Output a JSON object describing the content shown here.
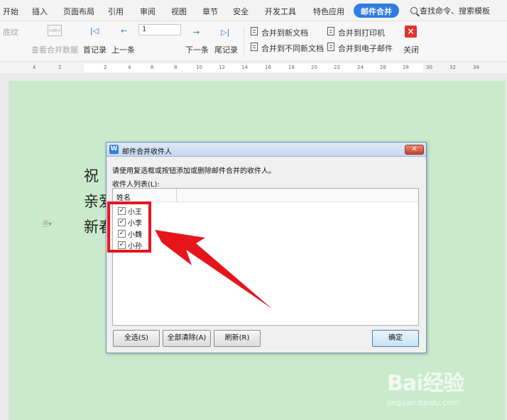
{
  "menubar": {
    "items": [
      "开始",
      "插入",
      "页面布局",
      "引用",
      "审阅",
      "视图",
      "章节",
      "安全",
      "开发工具",
      "特色应用",
      "邮件合并"
    ],
    "active_index": 10,
    "search": "查找命令、搜索模板",
    "accent_color": "#2f7de1"
  },
  "toolbar": {
    "shading": "底纹",
    "view_merged_data": "查看合并数据",
    "abc_icon": "«ab»",
    "first_record": "首记录",
    "prev_record": "上一条",
    "record_number": "1",
    "next_record": "下一条",
    "last_record": "尾记录",
    "merge_new_doc": "合并到新文档",
    "merge_diff_docs": "合并到不同新文档",
    "merge_printer": "合并到打印机",
    "merge_email": "合并到电子邮件",
    "close": "关闭"
  },
  "ruler": {
    "ticks": [
      "4",
      "2",
      "2",
      "4",
      "6",
      "8",
      "10",
      "12",
      "14",
      "16",
      "18",
      "20",
      "22",
      "24",
      "26",
      "28",
      "30",
      "32",
      "34"
    ]
  },
  "document": {
    "lines": [
      "祝",
      "亲爱",
      "新春"
    ]
  },
  "dialog": {
    "title": "邮件合并收件人",
    "instruction": "请使用复选框或按钮添加或删除邮件合并的收件人。",
    "list_label": "收件人列表(L):",
    "column_header": "姓名",
    "recipients": [
      {
        "name": "小王",
        "checked": true
      },
      {
        "name": "小李",
        "checked": true
      },
      {
        "name": "小魏",
        "checked": true
      },
      {
        "name": "小孙",
        "checked": true
      }
    ],
    "buttons": {
      "select_all": "全选(S)",
      "clear_all": "全部清除(A)",
      "refresh": "刷新(R)",
      "ok": "确定"
    }
  },
  "annotation": {
    "color": "#e8141c"
  },
  "watermark": {
    "logo": "Bai经验",
    "url": "jingyan.baidu.com"
  }
}
